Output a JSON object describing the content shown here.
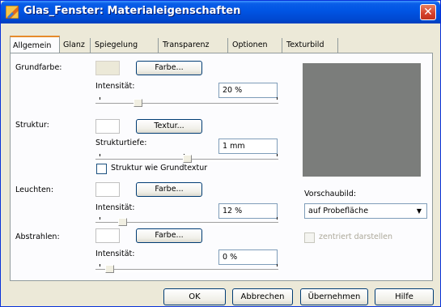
{
  "window": {
    "title": "Glas_Fenster: Materialeigenschaften",
    "close_glyph": "✕",
    "icon": "material-edit-icon"
  },
  "tabs": [
    {
      "label": "Allgemein",
      "active": true
    },
    {
      "label": "Glanz",
      "active": false
    },
    {
      "label": "Spiegelung",
      "active": false
    },
    {
      "label": "Transparenz",
      "active": false
    },
    {
      "label": "Optionen",
      "active": false
    },
    {
      "label": "Texturbild",
      "active": false
    }
  ],
  "grundfarbe": {
    "label": "Grundfarbe:",
    "button_label": "Farbe...",
    "slider_label": "Intensität:",
    "value": "20 %",
    "slider_fraction": 0.2
  },
  "struktur": {
    "label": "Struktur:",
    "button_label": "Textur...",
    "slider_label": "Strukturtiefe:",
    "value": "1 mm",
    "checkbox_label": "Struktur wie Grundtextur",
    "checkbox_checked": false
  },
  "leuchten": {
    "label": "Leuchten:",
    "button_label": "Farbe...",
    "slider_label": "Intensität:",
    "value": "12 %",
    "slider_fraction": 0.12
  },
  "abstrahlen": {
    "label": "Abstrahlen:",
    "button_label": "Farbe...",
    "slider_label": "Intensität:",
    "value": "0 %",
    "slider_fraction": 0.0
  },
  "preview": {
    "label": "Vorschaubild:",
    "selected": "auf Probefläche",
    "center_label": "zentriert darstellen",
    "center_checked": false,
    "color": "#7b7d7b"
  },
  "buttons": {
    "ok": "OK",
    "cancel": "Abbrechen",
    "apply": "Übernehmen",
    "help": "Hilfe"
  }
}
